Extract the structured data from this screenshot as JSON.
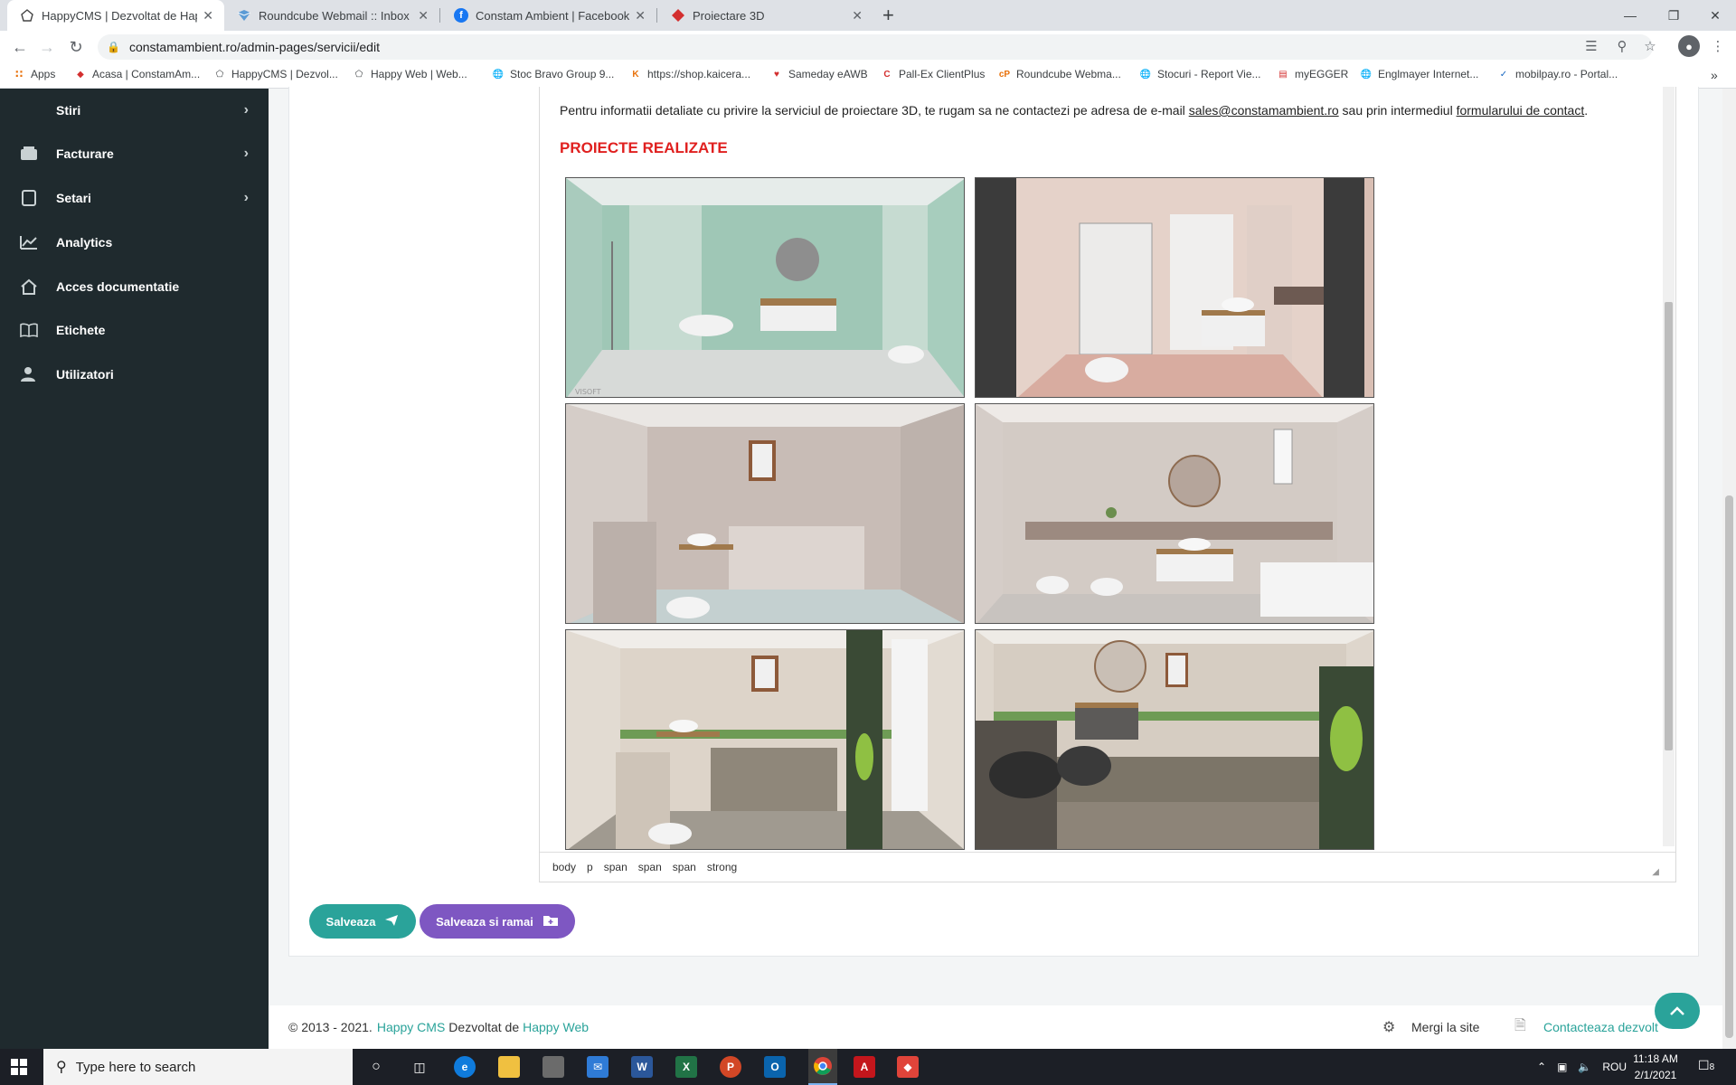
{
  "browser": {
    "tabs": [
      {
        "title": "HappyCMS | Dezvoltat de Happy",
        "close": "✕"
      },
      {
        "title": "Roundcube Webmail :: Inbox",
        "close": "✕"
      },
      {
        "title": "Constam Ambient | Facebook",
        "close": "✕"
      },
      {
        "title": "Proiectare 3D",
        "close": "✕"
      }
    ],
    "new_tab": "+",
    "url": "constamambient.ro/admin-pages/servicii/edit",
    "bookmarks": [
      "Apps",
      "Acasa | ConstamAm...",
      "HappyCMS | Dezvol...",
      "Happy Web | Web...",
      "Stoc Bravo Group 9...",
      "https://shop.kaicera...",
      "Sameday eAWB",
      "Pall-Ex ClientPlus",
      "Roundcube Webma...",
      "Stocuri - Report Vie...",
      "myEGGER",
      "Englmayer Internet...",
      "mobilpay.ro - Portal..."
    ],
    "bookmarks_more": "»"
  },
  "sidebar": {
    "items": [
      {
        "label": "Stiri",
        "icon": "news-icon",
        "has_submenu": true
      },
      {
        "label": "Facturare",
        "icon": "invoice-icon",
        "has_submenu": true
      },
      {
        "label": "Setari",
        "icon": "settings-icon",
        "has_submenu": true
      },
      {
        "label": "Analytics",
        "icon": "analytics-icon",
        "has_submenu": false
      },
      {
        "label": "Acces documentatie",
        "icon": "home-icon",
        "has_submenu": false
      },
      {
        "label": "Etichete",
        "icon": "book-icon",
        "has_submenu": false
      },
      {
        "label": "Utilizatori",
        "icon": "users-icon",
        "has_submenu": false
      }
    ]
  },
  "editor": {
    "text_before": "Pentru informatii detaliate cu privire la serviciul de proiectare 3D, te rugam sa ne contactezi pe adresa de e-mail ",
    "email": "sales@constamambient.ro",
    "text_middle": " sau prin intermediul ",
    "contact_link": "formularului de contact",
    "text_end": ".",
    "heading": "PROIECTE REALIZATE",
    "watermark": "VISOFT",
    "status_path": [
      "body",
      "p",
      "span",
      "span",
      "span",
      "strong"
    ]
  },
  "buttons": {
    "save": "Salveaza",
    "save_stay": "Salveaza si ramai"
  },
  "footer": {
    "copyright": "© 2013 - 2021.",
    "brand": "Happy CMS",
    "developed_by": "Dezvoltat de",
    "company": "Happy Web",
    "visit_site": "Mergi la site",
    "contact": "Contacteaza dezvolt"
  },
  "taskbar": {
    "search_placeholder": "Type here to search",
    "language": "ROU",
    "time": "11:18 AM",
    "date": "2/1/2021",
    "notifications": "8"
  },
  "colors": {
    "accent_teal": "#2aa39a",
    "accent_purple": "#7e57c2",
    "heading_red": "#e0201f",
    "sidebar_bg": "#1f2a2e"
  }
}
